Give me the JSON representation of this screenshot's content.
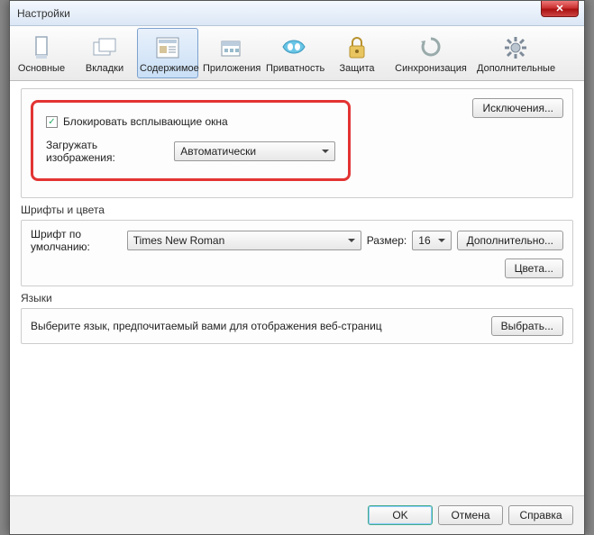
{
  "window": {
    "title": "Настройки",
    "close_icon": "✕"
  },
  "toolbar": {
    "items": [
      {
        "label": "Основные"
      },
      {
        "label": "Вкладки"
      },
      {
        "label": "Содержимое"
      },
      {
        "label": "Приложения"
      },
      {
        "label": "Приватность"
      },
      {
        "label": "Защита"
      },
      {
        "label": "Синхронизация"
      },
      {
        "label": "Дополнительные"
      }
    ],
    "selected_index": 2
  },
  "popups": {
    "block_label": "Блокировать всплывающие окна",
    "block_checked": "✓",
    "images_label": "Загружать изображения:",
    "images_value": "Автоматически",
    "exceptions_btn": "Исключения..."
  },
  "fonts": {
    "group_title": "Шрифты и цвета",
    "default_font_label": "Шрифт по умолчанию:",
    "default_font_value": "Times New Roman",
    "size_label": "Размер:",
    "size_value": "16",
    "advanced_btn": "Дополнительно...",
    "colors_btn": "Цвета..."
  },
  "languages": {
    "group_title": "Языки",
    "desc": "Выберите язык, предпочитаемый вами для отображения веб-страниц",
    "choose_btn": "Выбрать..."
  },
  "footer": {
    "ok": "OK",
    "cancel": "Отмена",
    "help": "Справка"
  }
}
